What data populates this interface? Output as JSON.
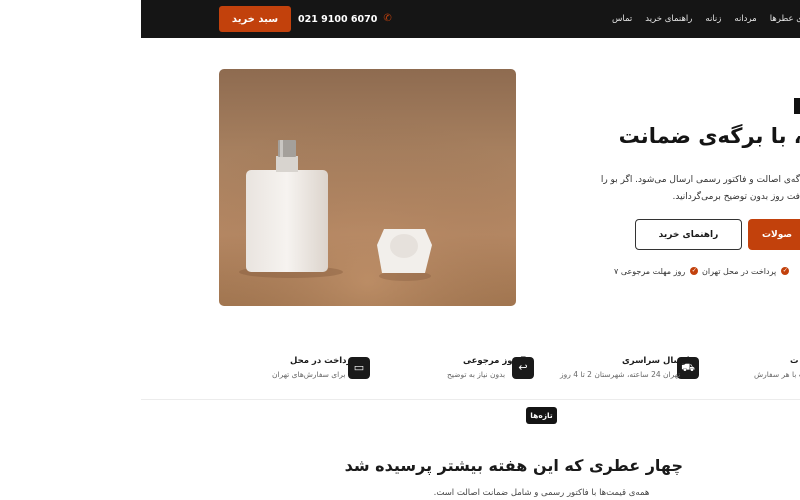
{
  "header": {
    "nav": [
      "همه‌ی عطرها",
      "مردانه",
      "زنانه",
      "راهنمای خرید",
      "تماس"
    ],
    "phone": "021 9100 6070",
    "cart_label": "سبد خرید"
  },
  "hero": {
    "title": "ل، با برگه‌ی ضمانت",
    "desc_line1": "گه‌ی اصالت و فاکتور رسمی ارسال می‌شود. اگر بو را",
    "desc_line2": "فت روز بدون توضیح برمی‌گردانید.",
    "btn_products": "صولات",
    "btn_guide": "راهنمای خرید",
    "feature_1": "پرداخت در محل تهران",
    "feature_2": "۷ روز مهلت مرجوعی"
  },
  "features": [
    {
      "title": "ت",
      "subtitle": "ت با هر سفارش"
    },
    {
      "title": "ارسال سراسری",
      "subtitle": "تهران 24 ساعته، شهرستان 2 تا 4 روز"
    },
    {
      "title": "7 روز مرجوعی",
      "subtitle": "بدون نیاز به توضیح"
    },
    {
      "title": "پرداخت در محل",
      "subtitle": "برای سفارش‌های تهران"
    }
  ],
  "section": {
    "badge": "تازه‌ها",
    "title": "چهار عطری که این هفته بیشتر پرسیده شد",
    "subtitle": "همه‌ی قیمت‌ها با فاکتور رسمی و شامل ضمانت اصالت است."
  },
  "colors": {
    "accent": "#c2410c",
    "header_bg": "#151515"
  }
}
